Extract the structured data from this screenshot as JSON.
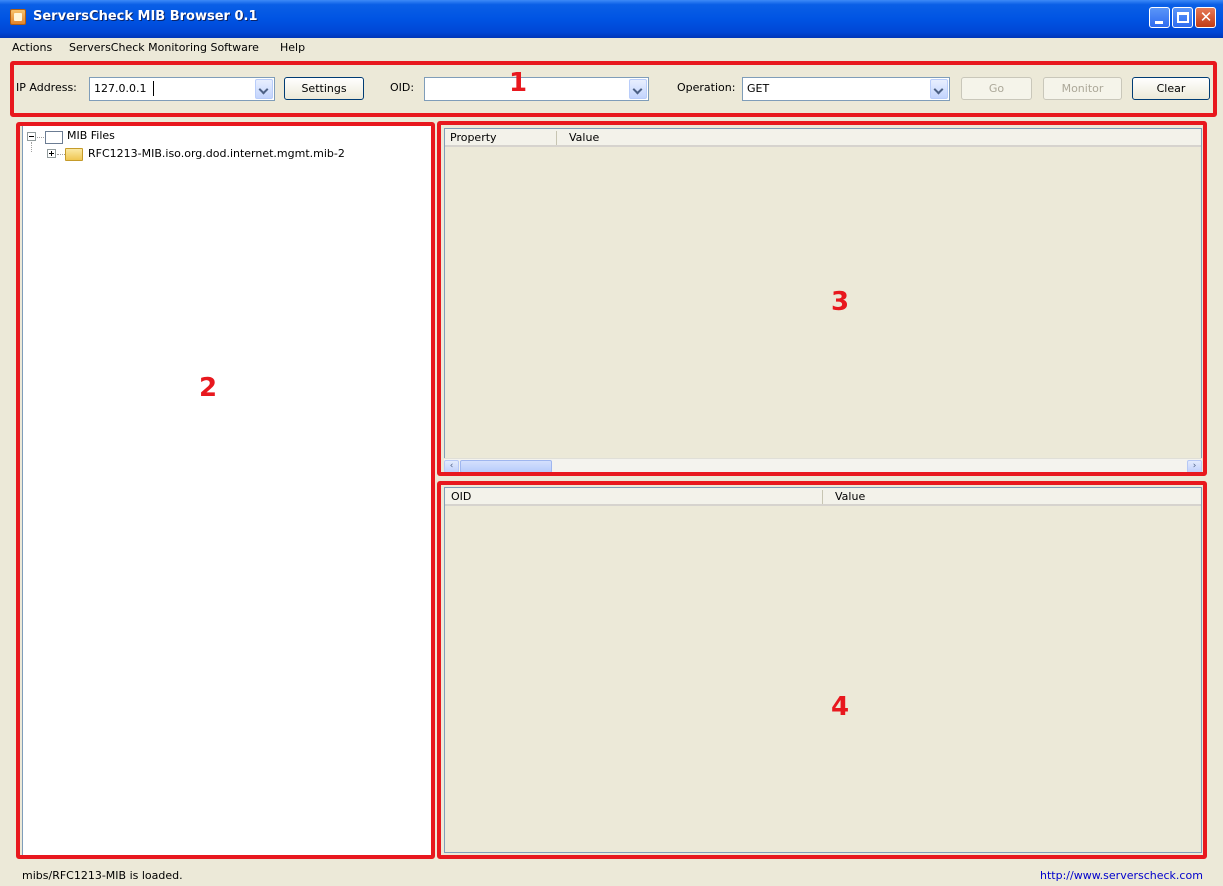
{
  "window": {
    "title": "ServersCheck MIB Browser 0.1"
  },
  "menu": [
    "Actions",
    "ServersCheck Monitoring Software",
    "Help"
  ],
  "toolbar": {
    "ip_label": "IP Address:",
    "ip_value": "127.0.0.1",
    "settings_label": "Settings",
    "oid_label": "OID:",
    "oid_value": "",
    "operation_label": "Operation:",
    "operation_value": "GET",
    "go_label": "Go",
    "monitor_label": "Monitor",
    "clear_label": "Clear"
  },
  "tree": {
    "root": "MIB Files",
    "children": [
      "RFC1213-MIB.iso.org.dod.internet.mgmt.mib-2"
    ]
  },
  "property_table": {
    "columns": [
      "Property",
      "Value"
    ]
  },
  "results_table": {
    "columns": [
      "OID",
      "Value"
    ]
  },
  "annotations": [
    "1",
    "2",
    "3",
    "4"
  ],
  "status": {
    "message": "mibs/RFC1213-MIB is loaded.",
    "link": "http://www.serverscheck.com"
  },
  "colors": {
    "annotation": "#e8181e",
    "titlebar": "#0054e3",
    "link": "#0000cc"
  }
}
